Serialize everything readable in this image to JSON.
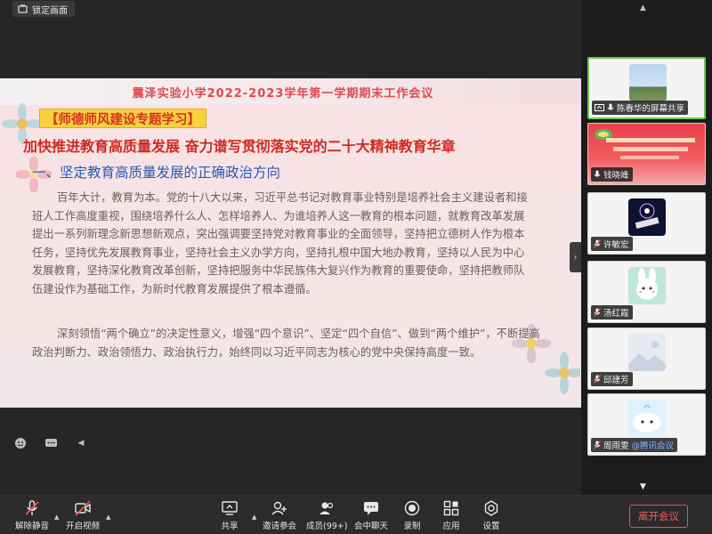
{
  "lock_button": {
    "label": "锁定画面"
  },
  "slide": {
    "title": "震泽实验小学2022-2023学年第一学期期末工作会议",
    "tag": "【师德师风建设专题学习】",
    "subtitle": "加快推进教育高质量发展 奋力谱写贯彻落实党的二十大精神教育华章",
    "section_heading": "一、坚定教育高质量发展的正确政治方向",
    "paragraph_1": "百年大计，教育为本。党的十八大以来，习近平总书记对教育事业特别是培养社会主义建设者和接班人工作高度重视，围绕培养什么人、怎样培养人、为谁培养人这一教育的根本问题，就教育改革发展提出一系列新理念新思想新观点，突出强调要坚持党对教育事业的全面领导，坚持把立德树人作为根本任务，坚持优先发展教育事业，坚持社会主义办学方向，坚持扎根中国大地办教育，坚持以人民为中心发展教育，坚持深化教育改革创新，坚持把服务中华民族伟大复兴作为教育的重要使命，坚持把教师队伍建设作为基础工作，为新时代教育发展提供了根本遵循。",
    "paragraph_2": "深刻领悟“两个确立”的决定性意义，增强“四个意识”、坚定“四个自信”、做到“两个维护”，不断提高政治判断力、政治领悟力、政治执行力，始终同以习近平同志为核心的党中央保持高度一致。"
  },
  "participants": [
    {
      "name": "陈春华的屏幕共享",
      "mic_icon": "mic-icon",
      "type": "screen-share"
    },
    {
      "name": "钱晓峰",
      "type": "slide"
    },
    {
      "name": "许敏宏",
      "mic_icon": "mic-muted-icon"
    },
    {
      "name": "汤红霞",
      "mic_icon": "mic-muted-icon"
    },
    {
      "name": "邱建芳",
      "mic_icon": "mic-muted-icon"
    },
    {
      "name": "周雨雯",
      "suffix": "@腾讯会议",
      "mic_icon": "mic-muted-icon"
    }
  ],
  "toolbar": {
    "unmute": "解除静音",
    "start_video": "开启视频",
    "share": "共享",
    "invite": "邀请参会",
    "members": "成员(99+)",
    "chat": "会中聊天",
    "record": "录制",
    "apps": "应用",
    "settings": "设置",
    "leave": "离开会议"
  },
  "colors": {
    "leave_red": "#f05b52",
    "slide_title_red": "#e04a4a",
    "section_blue": "#2a59b6",
    "tag_yellow": "#f7d23b",
    "active_speaker_green": "#6ac74e"
  }
}
